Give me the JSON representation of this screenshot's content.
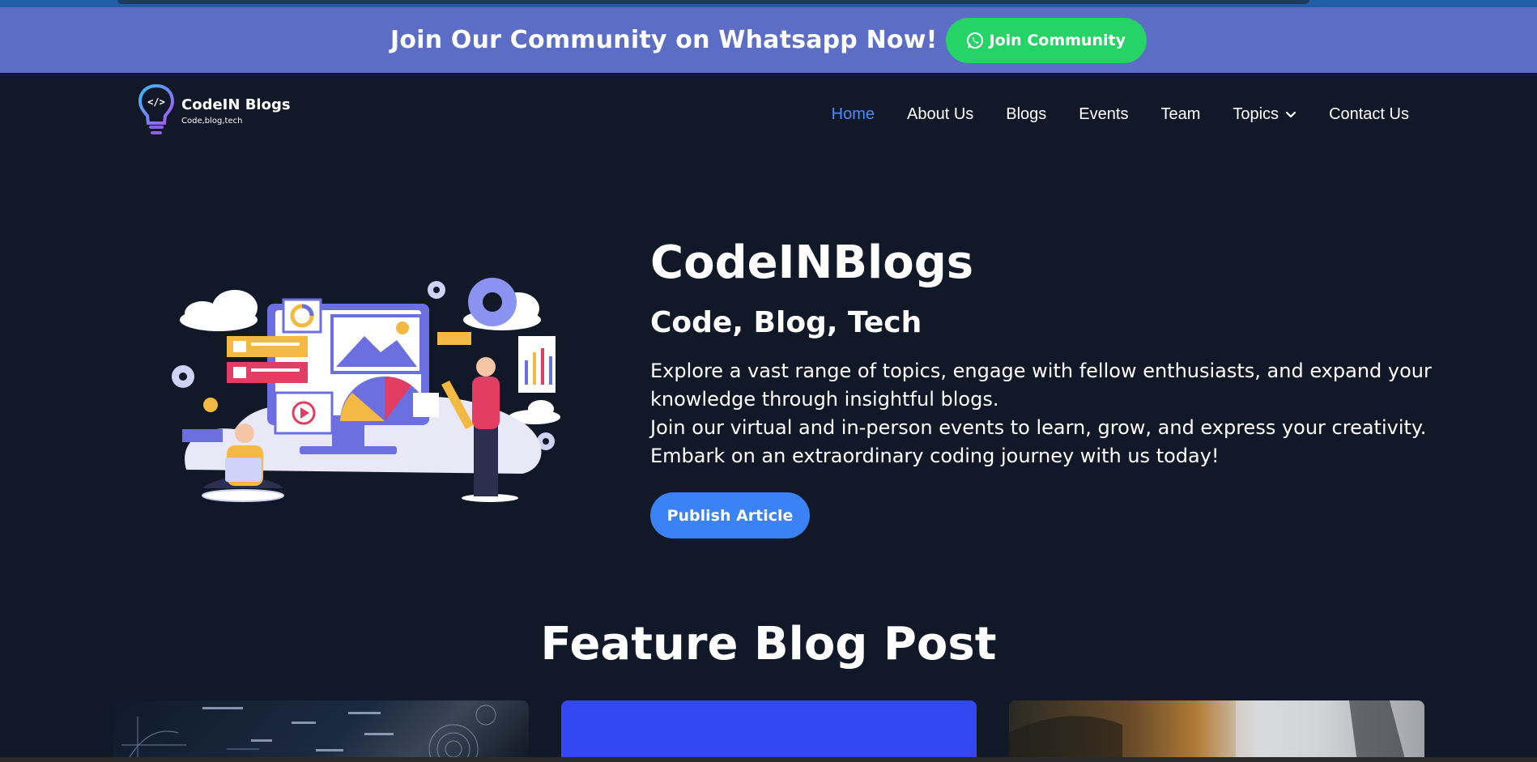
{
  "banner": {
    "text": "Join Our Community on Whatsapp Now!",
    "button_label": "Join Community",
    "button_icon": "whatsapp-icon",
    "background": "#5b6dc4",
    "button_color": "#25d366"
  },
  "logo": {
    "title": "CodeIN Blogs",
    "tagline": "Code,blog,tech",
    "icon": "lightbulb-code-icon"
  },
  "nav": {
    "items": [
      {
        "label": "Home",
        "active": true
      },
      {
        "label": "About Us"
      },
      {
        "label": "Blogs"
      },
      {
        "label": "Events"
      },
      {
        "label": "Team"
      },
      {
        "label": "Topics",
        "has_dropdown": true
      },
      {
        "label": "Contact Us"
      }
    ],
    "active_color": "#4b8cf6"
  },
  "hero": {
    "title": "CodeINBlogs",
    "subtitle": "Code, Blog, Tech",
    "description": [
      "Explore a vast range of topics, engage with fellow enthusiasts, and expand your",
      "knowledge through insightful blogs.",
      "Join our virtual and in-person events to learn, grow, and express your creativity.",
      "Embark on an extraordinary coding journey with us today!"
    ],
    "button_label": "Publish Article",
    "button_color": "#3b82f6"
  },
  "feature": {
    "title": "Feature Blog Post"
  },
  "colors": {
    "page_background": "#111827",
    "text": "#ffffff"
  }
}
